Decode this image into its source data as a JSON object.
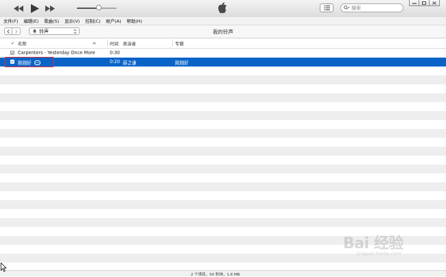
{
  "menu": [
    "文件(F)",
    "编辑(E)",
    "歌曲(S)",
    "显示(V)",
    "控制(C)",
    "帐户(A)",
    "帮助(H)"
  ],
  "search": {
    "placeholder": "搜索"
  },
  "player": {
    "volume": 0.55
  },
  "nav": {
    "source_label": "铃声",
    "page_title": "我的铃声"
  },
  "table": {
    "headers": {
      "name": "名称",
      "time": "时间",
      "artist": "表演者",
      "album": "专辑"
    },
    "rows": [
      {
        "checked": true,
        "name": "Carpenters - Yesterday Once More",
        "time": "0:30",
        "artist": "",
        "album": "",
        "selected": false
      },
      {
        "checked": true,
        "name": "刚刚好",
        "time": "0:20",
        "artist": "薛之谦",
        "album": "刚刚好",
        "selected": true
      }
    ]
  },
  "status": {
    "text": "2 个项目，50 秒钟，1.6 MB"
  },
  "watermark": {
    "main": "Bai 经验",
    "sub": "jingyan.baidu.com"
  },
  "colors": {
    "selection": "#0a64c8",
    "highlight_box": "#e02a3c"
  },
  "icons": [
    "rewind-icon",
    "play-icon",
    "fast-forward-icon",
    "apple-logo-icon",
    "list-view-icon",
    "search-icon",
    "back-icon",
    "forward-icon",
    "bell-icon",
    "chevron-updown-icon",
    "sort-up-icon",
    "more-options-icon",
    "mouse-cursor-icon"
  ]
}
